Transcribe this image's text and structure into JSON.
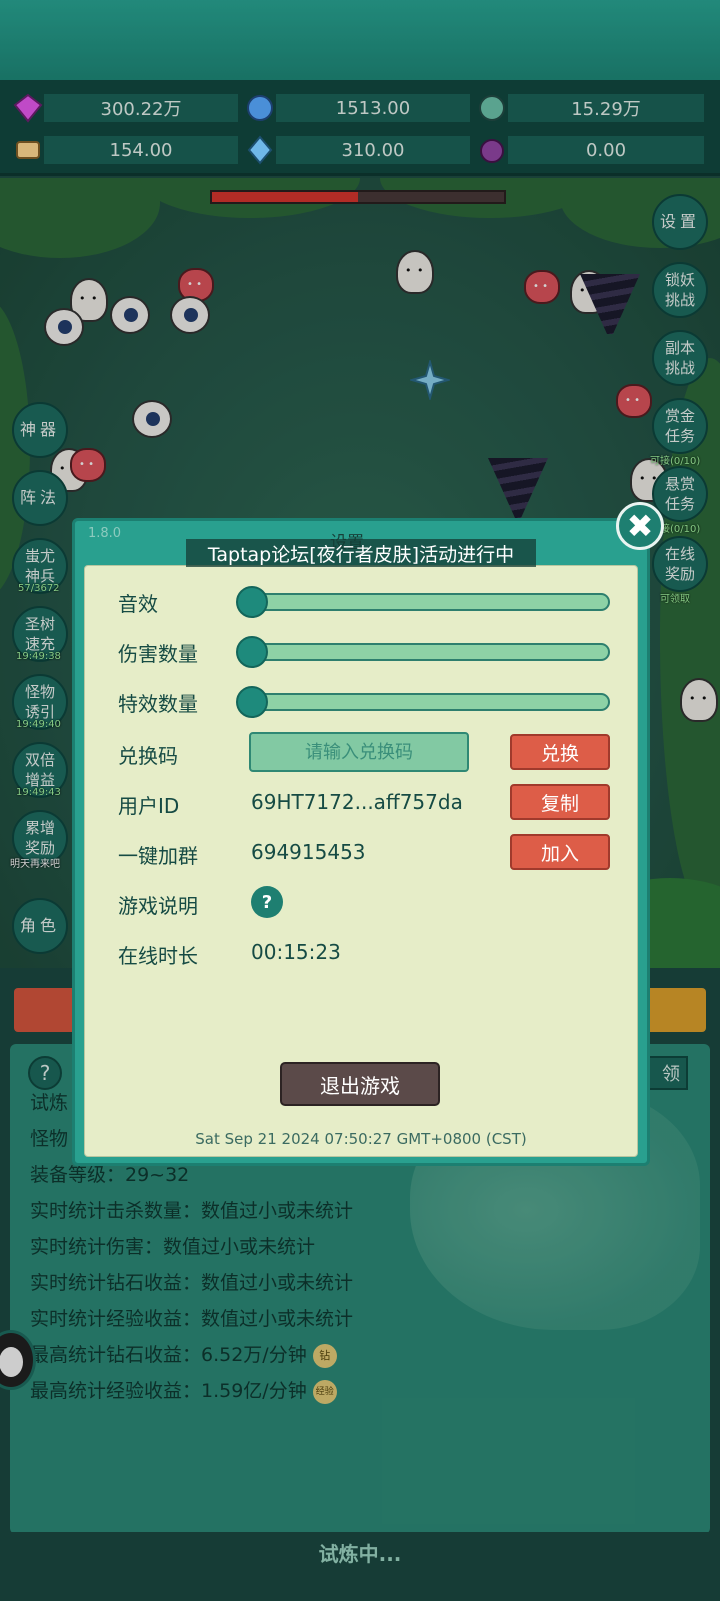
{
  "resources": {
    "diamond": "300.22万",
    "crystal": "1513.00",
    "orb": "15.29万",
    "scroll": "154.00",
    "shard": "310.00",
    "potion": "0.00"
  },
  "side_left": {
    "shenqi": "神器",
    "zhenfa": "阵法",
    "chiyou": "蚩尤神兵",
    "chiyou_sub": "57/3672",
    "shengshu": "圣树速充",
    "shengshu_sub": "19:49:38",
    "guaiwu": "怪物诱引",
    "guaiwu_sub": "19:49:40",
    "shuangbei": "双倍增益",
    "shuangbei_sub": "19:49:43",
    "leizeng": "累增奖励",
    "leizeng_sub": "明天再来吧",
    "juese": "角色"
  },
  "side_right": {
    "settings": "设置",
    "suoyao": "锁妖挑战",
    "fuben": "副本挑战",
    "shangjin": "赏金任务",
    "shangjin_sub": "可接(0/10)",
    "xuanshang": "悬赏任务",
    "xuanshang_sub": "接(0/10)",
    "zaixian": "在线奖励",
    "zaixian_sub": "可领取"
  },
  "stats": {
    "question": "?",
    "right_btn": "领",
    "line1": "试炼",
    "line2": "怪物",
    "line3": "装备等级：29~32",
    "line4": "实时统计击杀数量：数值过小或未统计",
    "line5": "实时统计伤害：数值过小或未统计",
    "line6": "实时统计钻石收益：数值过小或未统计",
    "line7": "实时统计经验收益：数值过小或未统计",
    "line8": "最高统计钻石收益：6.52万/分钟",
    "line8_tag": "钻",
    "line9": "最高统计经验收益：1.59亿/分钟",
    "line9_tag": "经验",
    "trial_status": "试炼中..."
  },
  "dialog": {
    "version": "1.8.0",
    "title": "设置",
    "banner": "Taptap论坛[夜行者皮肤]活动进行中",
    "close": "✖",
    "sound_label": "音效",
    "damage_label": "伤害数量",
    "effect_label": "特效数量",
    "sound_level": 0,
    "damage_level": 0,
    "effect_level": 0,
    "code_label": "兑换码",
    "code_placeholder": "请输入兑换码",
    "redeem_btn": "兑换",
    "uid_label": "用户ID",
    "uid_value": "69HT7172...aff757da",
    "copy_btn": "复制",
    "group_label": "一键加群",
    "group_value": "694915453",
    "join_btn": "加入",
    "guide_label": "游戏说明",
    "guide_btn": "?",
    "online_label": "在线时长",
    "online_value": "00:15:23",
    "exit_btn": "退出游戏",
    "datetime": "Sat Sep 21 2024 07:50:27 GMT+0800 (CST)"
  }
}
